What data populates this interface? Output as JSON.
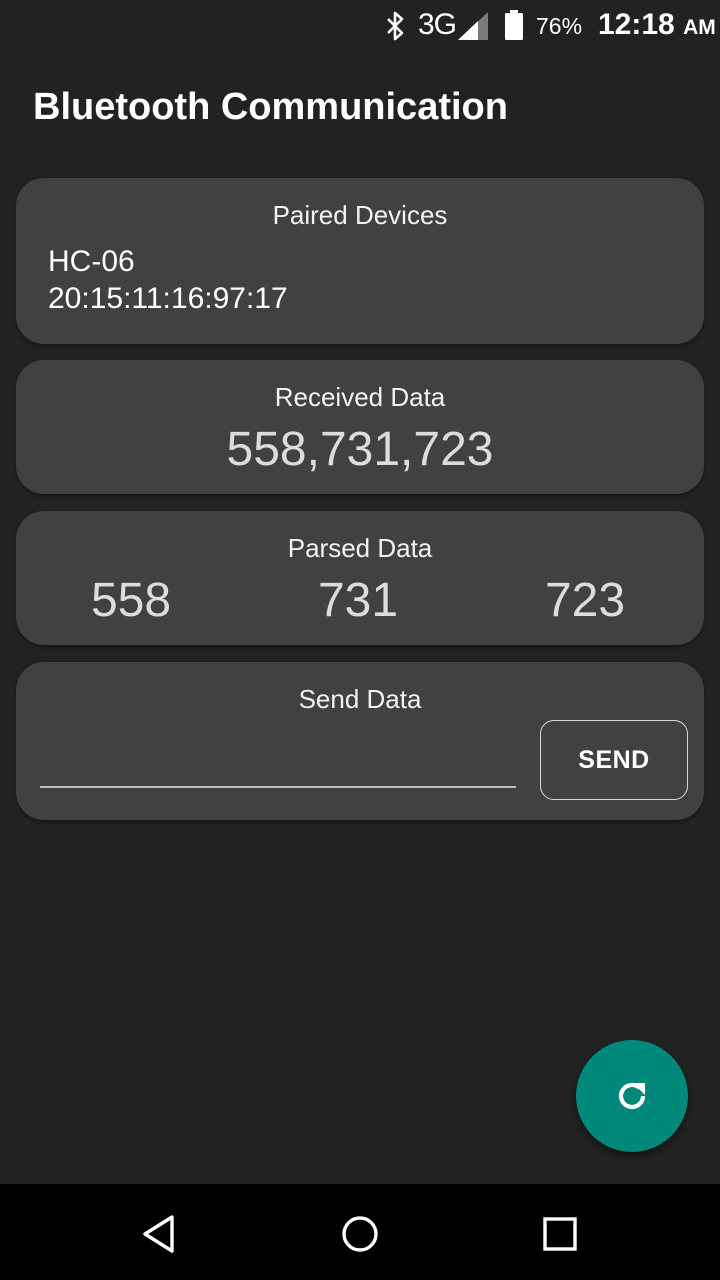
{
  "status_bar": {
    "bluetooth_icon": "bluetooth-icon",
    "network": "3G",
    "signal_icon": "cell-signal-icon",
    "battery_icon": "battery-icon",
    "battery_percent": "76%",
    "time": "12:18",
    "ampm": "AM"
  },
  "app": {
    "title": "Bluetooth Communication"
  },
  "paired_devices": {
    "title": "Paired Devices",
    "device_name": "HC-06",
    "device_address": "20:15:11:16:97:17"
  },
  "received_data": {
    "title": "Received Data",
    "value": "558,731,723"
  },
  "parsed_data": {
    "title": "Parsed Data",
    "values": [
      "558",
      "731",
      "723"
    ]
  },
  "send_data": {
    "title": "Send Data",
    "input_value": "",
    "button_label": "SEND"
  },
  "fab": {
    "icon": "refresh-icon",
    "color": "#00897b"
  },
  "nav_bar": {
    "icons": [
      "back-icon",
      "home-icon",
      "recents-icon"
    ]
  },
  "colors": {
    "background": "#222222",
    "card": "#414141",
    "accent": "#00897b"
  }
}
